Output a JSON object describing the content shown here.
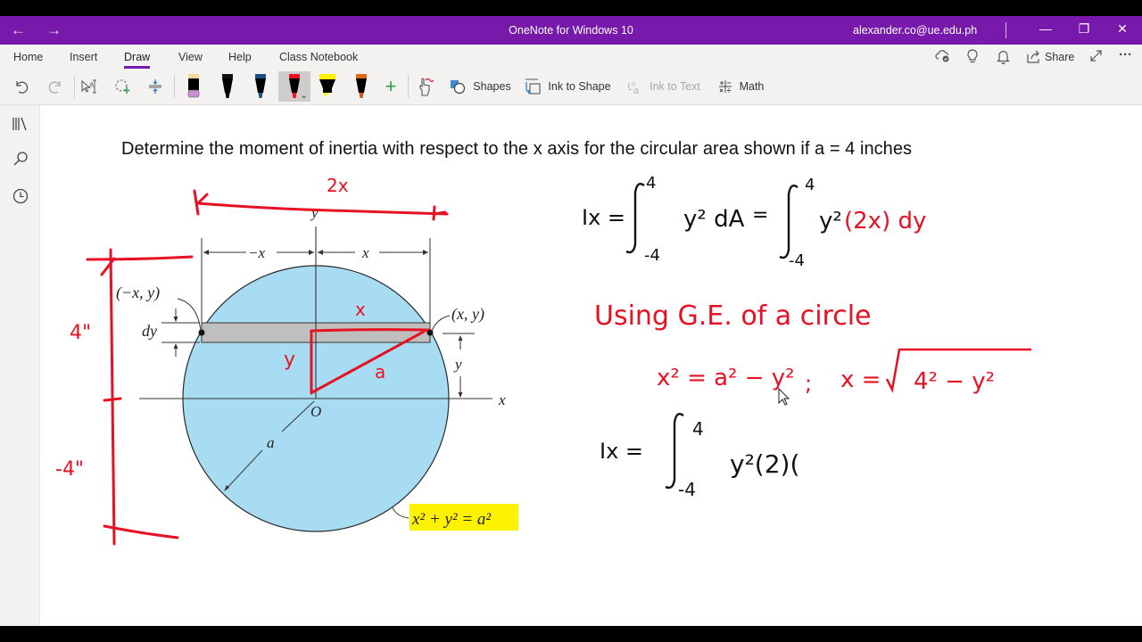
{
  "window": {
    "title": "OneNote for Windows 10",
    "account": "alexander.co@ue.edu.ph",
    "back_icon": "←",
    "forward_icon": "→",
    "minimize_icon": "—",
    "restore_icon": "❐",
    "close_icon": "✕"
  },
  "ribbon": {
    "tabs": [
      {
        "label": "Home"
      },
      {
        "label": "Insert"
      },
      {
        "label": "Draw",
        "active": true
      },
      {
        "label": "View"
      },
      {
        "label": "Help"
      },
      {
        "label": "Class Notebook"
      }
    ],
    "right_actions": {
      "share_label": "Share",
      "more_icon": "···"
    },
    "pens": [
      {
        "name": "pen-tan-purple",
        "cap": "#f2d89b",
        "body": "#000000",
        "tip": "#c88fd0"
      },
      {
        "name": "pen-black",
        "cap": "#111111",
        "body": "#000000",
        "tip": "#000000"
      },
      {
        "name": "pen-blue",
        "cap": "#1b4f86",
        "body": "#000000",
        "tip": "#1b4f86"
      },
      {
        "name": "pen-red",
        "cap": "#e81123",
        "body": "#000000",
        "tip": "#e81123",
        "selected": true
      },
      {
        "name": "highlighter-yellow",
        "cap": "#fff100",
        "body": "#000000",
        "tip": "#fff100"
      },
      {
        "name": "pen-orange",
        "cap": "#e06a1b",
        "body": "#000000",
        "tip": "#c65b17"
      }
    ],
    "tools": {
      "shapes": "Shapes",
      "ink_to_shape": "Ink to Shape",
      "ink_to_text": "Ink to Text",
      "math": "Math",
      "add_pen": "+"
    }
  },
  "colors": {
    "accent": "#7719aa",
    "ink_red": "#e81123",
    "circle_fill": "#a8dcf3",
    "strip_fill": "#bfbfbf",
    "highlight": "#fff200"
  },
  "page": {
    "question": "Determine the moment of inertia with respect to the x axis for the circular area shown if a = 4 inches",
    "figure": {
      "labels": {
        "y_axis": "y",
        "x_axis": "x",
        "origin": "O",
        "neg_x": "−x",
        "pos_x": "x",
        "left_point": "(−x, y)",
        "right_point": "(x, y)",
        "dy": "dy",
        "y_dim": "y",
        "radius": "a",
        "equation": "x² + y² = a²"
      },
      "ink_annotations": {
        "width": "2x",
        "top_half": "4\"",
        "bottom_half": "-4\"",
        "strip_half": "x",
        "height": "y",
        "hyp": "a"
      }
    },
    "notes": {
      "line1": {
        "lhs": "Ix =",
        "integral_upper": "4",
        "integral_lower": "-4",
        "integrand": "y² dA",
        "eq": "=",
        "integral2_upper": "4",
        "integral2_lower": "-4",
        "integrand2_black": "y²",
        "integrand2_red": "(2x) dy"
      },
      "line2": "Using G.E. of a circle",
      "line3": {
        "left": "x² = a² − y²",
        "sep": ";",
        "right_lhs": "x =",
        "radicand": "4² − y²"
      },
      "line4": {
        "lhs": "Ix =",
        "integral_upper": "4",
        "integral_lower": "-4",
        "integrand": "y²(2)("
      }
    }
  }
}
